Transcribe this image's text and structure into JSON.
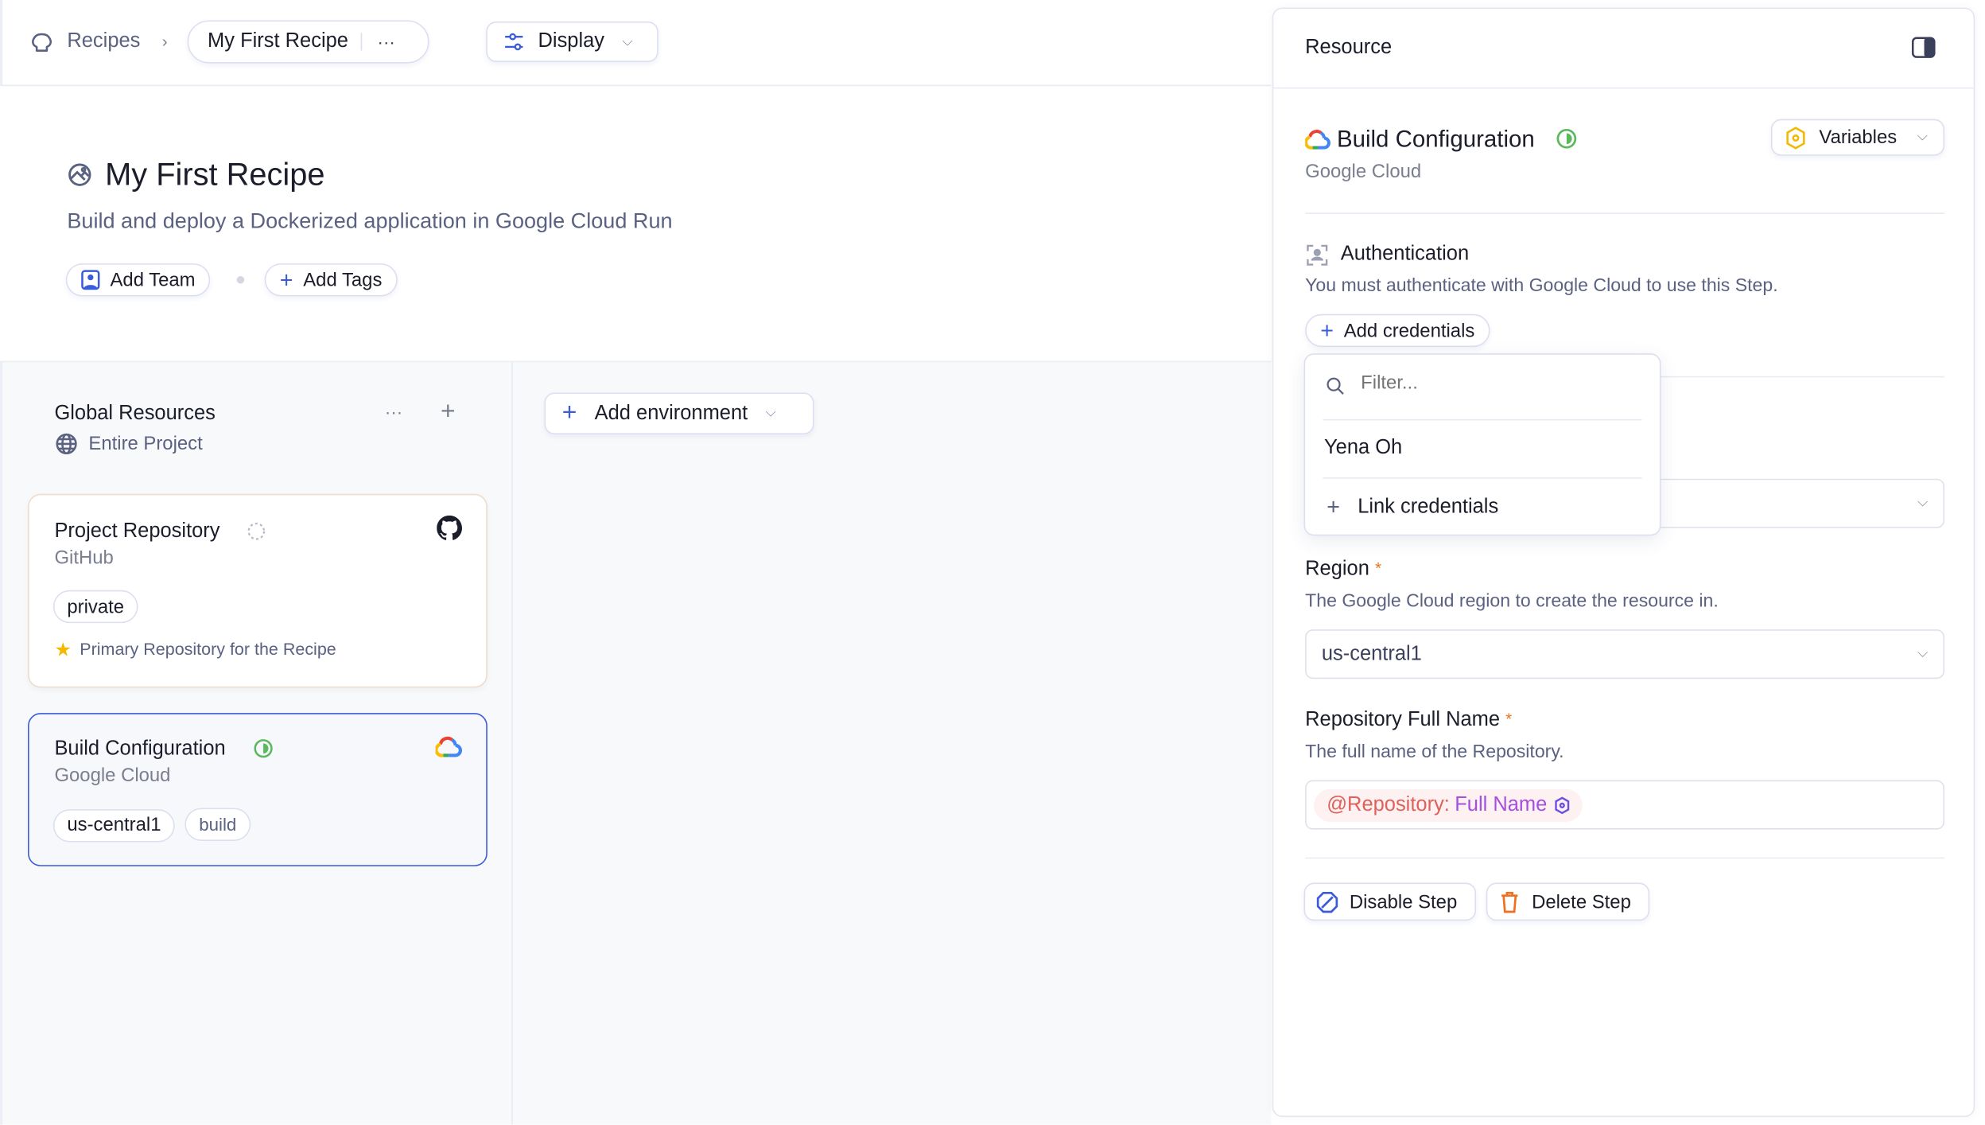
{
  "breadcrumb": {
    "root": "Recipes",
    "current": "My First Recipe",
    "more": "···"
  },
  "toolbar": {
    "display": "Display"
  },
  "recipe": {
    "title": "My First Recipe",
    "description": "Build and deploy a Dockerized application in Google Cloud Run",
    "add_team": "Add Team",
    "add_tags": "Add Tags"
  },
  "global": {
    "title": "Global Resources",
    "scope": "Entire Project",
    "more": "···",
    "add": "+"
  },
  "cards": [
    {
      "title": "Project Repository",
      "provider": "GitHub",
      "tags": [
        "private"
      ],
      "note": "Primary Repository for the Recipe",
      "status": "pending"
    },
    {
      "title": "Build Configuration",
      "provider": "Google Cloud",
      "tags": [
        "us-central1",
        "build"
      ],
      "status": "active",
      "selected": true
    }
  ],
  "add_environment": "Add environment",
  "panel": {
    "header": "Resource",
    "title": "Build Configuration",
    "provider": "Google Cloud",
    "variables": "Variables",
    "auth": {
      "title": "Authentication",
      "description": "You must authenticate with Google Cloud to use this Step.",
      "add_credentials": "Add credentials"
    },
    "dropdown": {
      "filter_placeholder": "Filter...",
      "items": [
        "Yena Oh"
      ],
      "link": "Link credentials"
    },
    "region": {
      "label": "Region",
      "required": "*",
      "description": "The Google Cloud region to create the resource in.",
      "value": "us-central1"
    },
    "repo": {
      "label": "Repository Full Name",
      "required": "*",
      "description": "The full name of the Repository.",
      "chip_prefix": "@Repository:",
      "chip_value": "Full Name"
    },
    "disable": "Disable Step",
    "delete": "Delete Step"
  },
  "colors": {
    "accent": "#3b5bdb",
    "success": "#5cb85c",
    "warning": "#f5b800",
    "danger": "#f07020",
    "required": "#f07020"
  }
}
